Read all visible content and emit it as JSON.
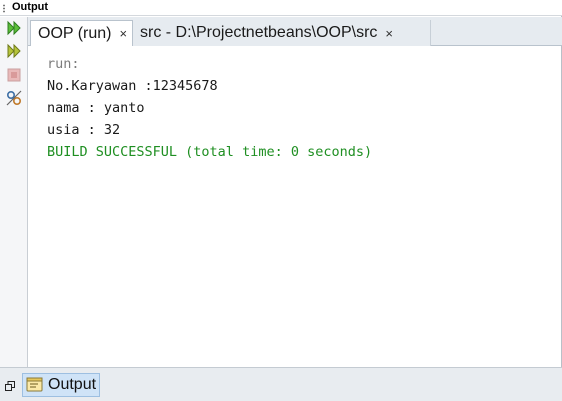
{
  "panel": {
    "title": "Output"
  },
  "tabs": [
    {
      "label": "OOP (run)",
      "close": "×",
      "active": true
    },
    {
      "label": "src - D:\\Projectnetbeans\\OOP\\src",
      "close": "×",
      "active": false
    }
  ],
  "toolbar": {
    "icons": [
      "rerun-icon",
      "rerun-with-options-icon",
      "stop-icon",
      "settings-icon"
    ]
  },
  "console": {
    "lines": [
      {
        "text": "run:",
        "style": "muted"
      },
      {
        "text": "No.Karyawan :12345678",
        "style": "normal"
      },
      {
        "text": "nama : yanto",
        "style": "normal"
      },
      {
        "text": "usia : 32",
        "style": "normal"
      },
      {
        "text": "BUILD SUCCESSFUL (total time: 0 seconds)",
        "style": "success"
      }
    ]
  },
  "bottom": {
    "output_label": "Output"
  },
  "colors": {
    "success": "#1f8f22",
    "muted": "#7c7c7c",
    "selected_bg": "#cfe3f7"
  }
}
